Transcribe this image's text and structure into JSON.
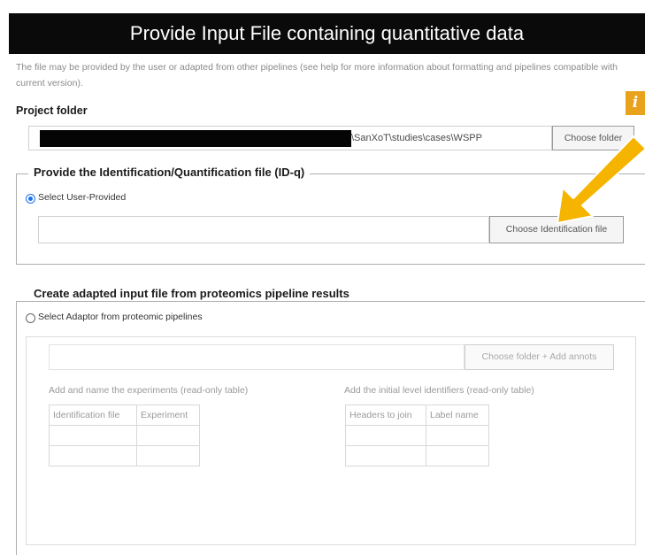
{
  "title": "Provide Input File containing quantitative data",
  "description": "The file may be provided by the user or adapted from other pipelines (see help for more information about formatting and pipelines compatible with current version).",
  "info_icon": "i",
  "project_folder": {
    "label": "Project folder",
    "path": "\\SanXoT\\studies\\cases\\WSPP",
    "button": "Choose folder"
  },
  "idq_section": {
    "legend": "Provide the Identification/Quantification file (ID-q)",
    "radio_label": "Select User-Provided",
    "selected": true,
    "input_value": "",
    "button": "Choose Identification file"
  },
  "adaptor_section": {
    "legend": "Create adapted input file from proteomics pipeline results",
    "radio_label": "Select Adaptor from proteomic pipelines",
    "selected": false,
    "input_value": "",
    "button": "Choose folder + Add annots",
    "experiments_caption": "Add and name the experiments (read-only table)",
    "experiments_headers": [
      "Identification file",
      "Experiment"
    ],
    "identifiers_caption": "Add the initial level identifiers (read-only table)",
    "identifiers_headers": [
      "Headers to join",
      "Label name"
    ]
  },
  "colors": {
    "title_bg": "#0a0a0a",
    "info_icon": "#e8a21c",
    "arrow": "#f5b400",
    "radio_selected": "#1a73e8"
  }
}
